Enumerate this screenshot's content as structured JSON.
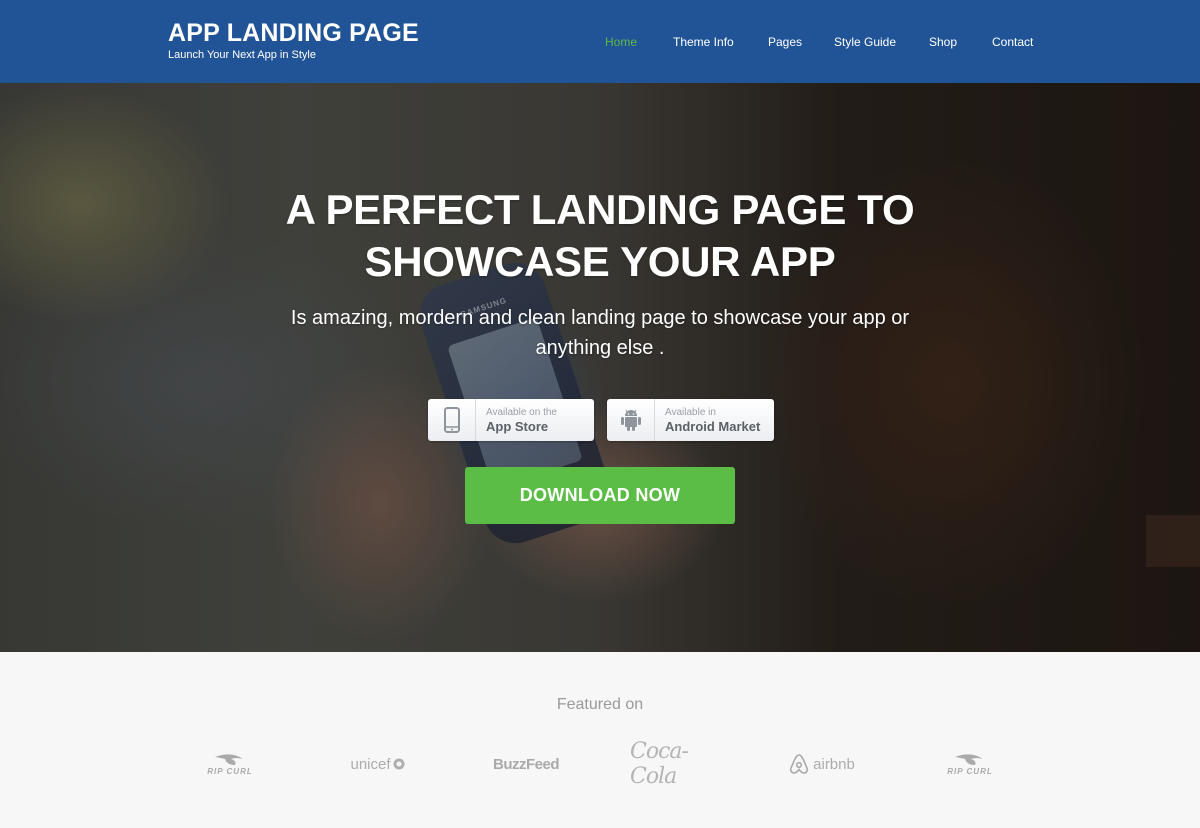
{
  "header": {
    "brand_title": "APP LANDING PAGE",
    "brand_tagline": "Launch Your Next App in Style",
    "background_color": "#215497",
    "nav": [
      {
        "label": "Home",
        "active": true
      },
      {
        "label": "Theme Info",
        "active": false
      },
      {
        "label": "Pages",
        "active": false
      },
      {
        "label": "Style Guide",
        "active": false
      },
      {
        "label": "Shop",
        "active": false
      },
      {
        "label": "Contact",
        "active": false
      }
    ],
    "active_color": "#5cbb46"
  },
  "hero": {
    "phone_brand": "SAMSUNG",
    "title": "A PERFECT LANDING PAGE TO SHOWCASE YOUR APP",
    "subtitle": "Is amazing, mordern and clean landing page to showcase your app or anything else .",
    "store_buttons": [
      {
        "icon": "smartphone-icon",
        "small_text": "Available on the",
        "big_text": "App Store"
      },
      {
        "icon": "android-icon",
        "small_text": "Available in",
        "big_text": "Android Market"
      }
    ],
    "cta_label": "DOWNLOAD NOW",
    "cta_color": "#5bbd45"
  },
  "featured": {
    "title": "Featured on",
    "logos": [
      {
        "name": "Rip Curl",
        "text": "RIP CURL"
      },
      {
        "name": "UNICEF",
        "text": "unicef"
      },
      {
        "name": "BuzzFeed",
        "text": "BuzzFeed"
      },
      {
        "name": "Coca-Cola",
        "text": "Coca-Cola"
      },
      {
        "name": "Airbnb",
        "text": "airbnb"
      },
      {
        "name": "Rip Curl",
        "text": "RIP CURL"
      }
    ]
  }
}
